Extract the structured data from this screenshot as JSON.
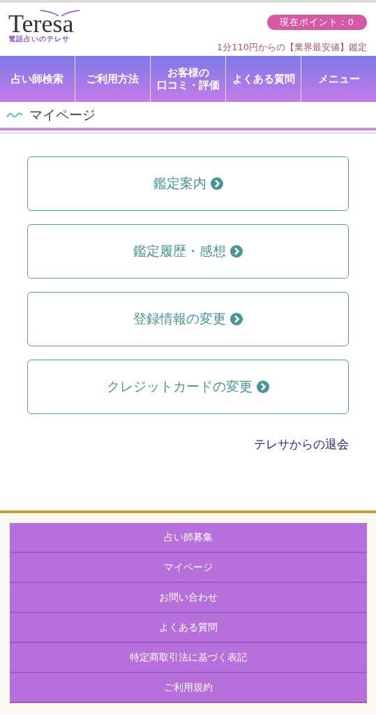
{
  "header": {
    "logo": "Teresa",
    "logo_subtitle": "電話占いのテレサ",
    "points": "現在ポイント：0",
    "tagline": "1分110円からの【業界最安値】鑑定"
  },
  "nav": [
    {
      "label": "占い師検索"
    },
    {
      "label": "ご利用方法"
    },
    {
      "lines": [
        "お客様の",
        "口コミ・評価"
      ]
    },
    {
      "label": "よくある質問"
    },
    {
      "label": "メニュー"
    }
  ],
  "page_title": "マイページ",
  "menu_buttons": [
    {
      "label": "鑑定案内"
    },
    {
      "label": "鑑定履歴・感想"
    },
    {
      "label": "登録情報の変更"
    },
    {
      "label": "クレジットカードの変更"
    }
  ],
  "withdraw_link": "テレサからの退会",
  "footer_links": [
    {
      "label": "占い師募集"
    },
    {
      "label": "マイページ"
    },
    {
      "label": "お問い合わせ"
    },
    {
      "label": "よくある質問"
    },
    {
      "label": "特定商取引法に基づく表記"
    },
    {
      "label": "ご利用規約"
    }
  ]
}
